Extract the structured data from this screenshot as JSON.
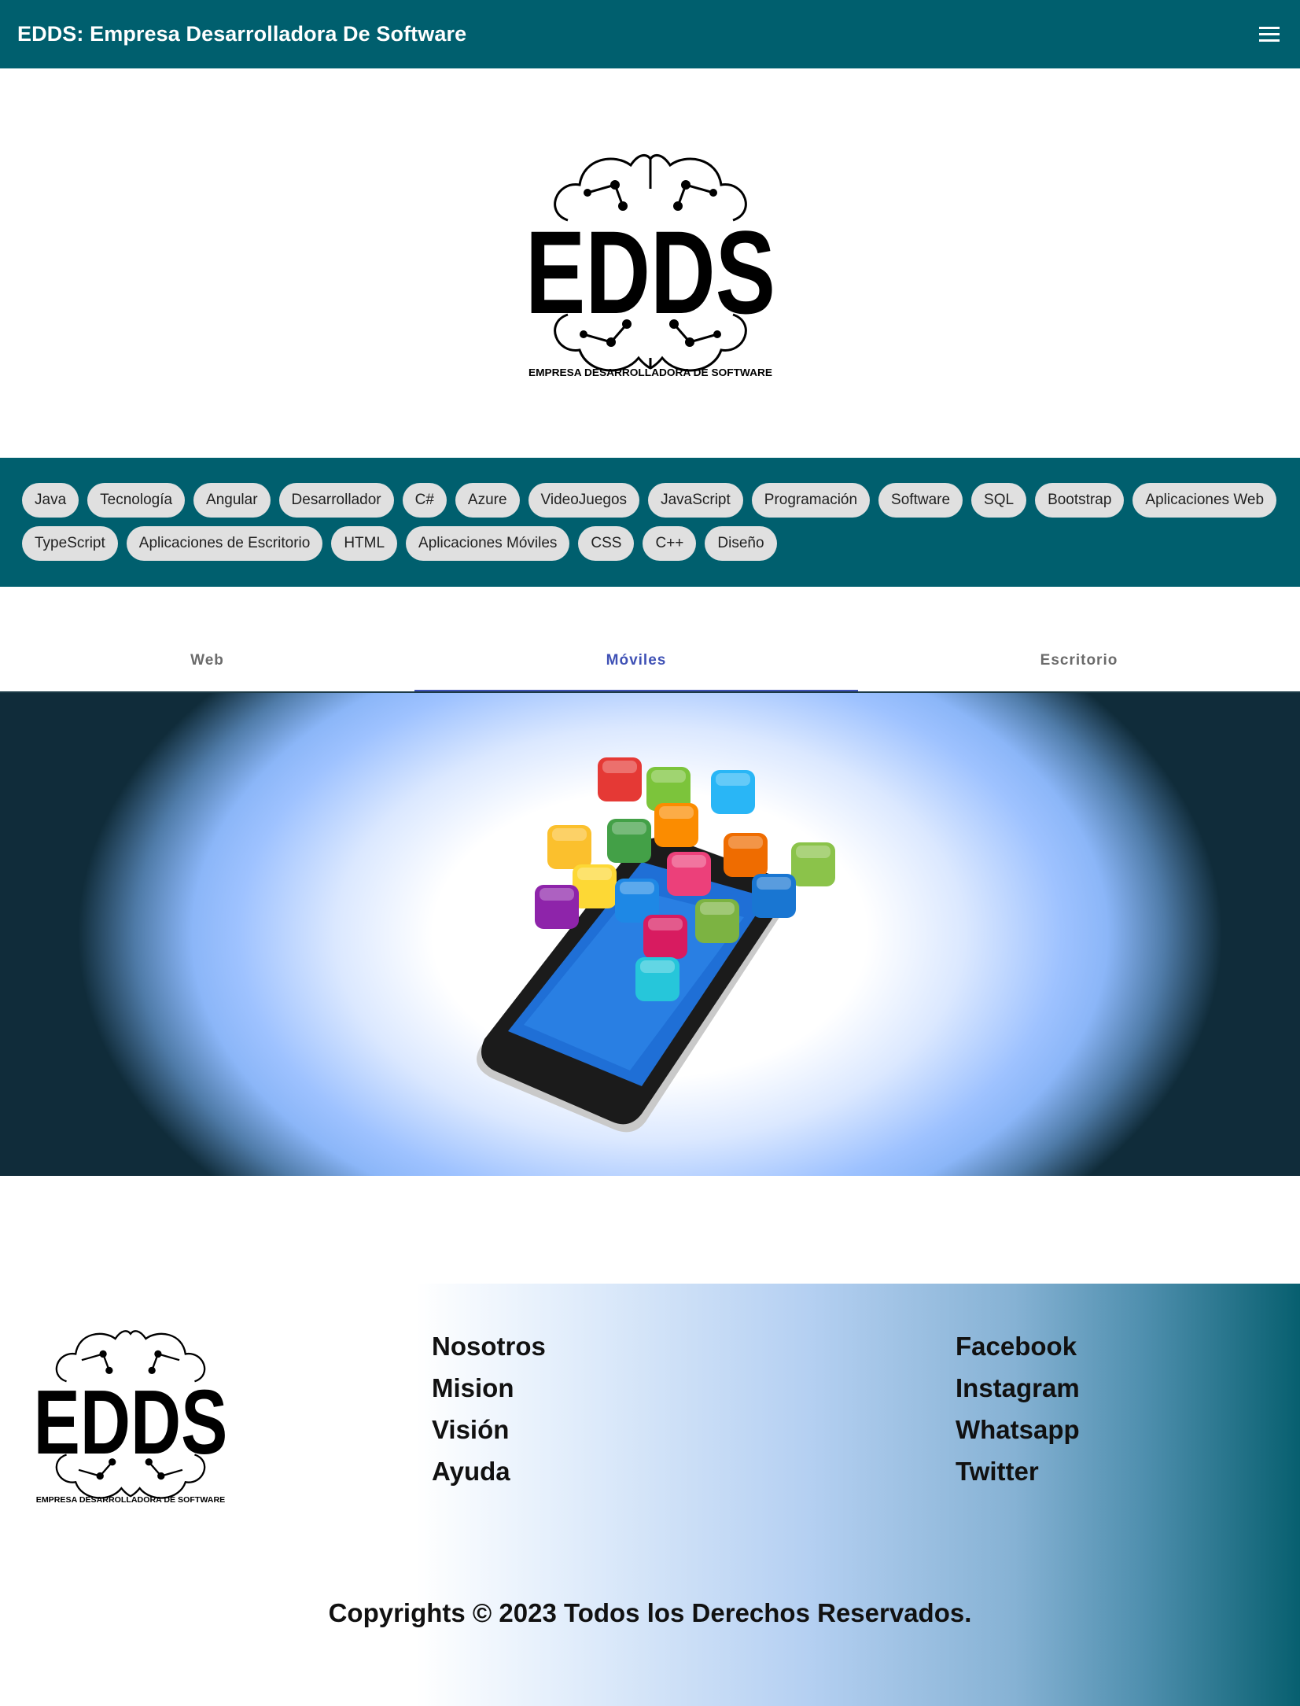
{
  "header": {
    "title": "EDDS: Empresa Desarrolladora De Software"
  },
  "logo": {
    "letters": "EDDS",
    "tagline": "EMPRESA DESARROLLADORA DE SOFTWARE"
  },
  "chips": [
    "Java",
    "Tecnología",
    "Angular",
    "Desarrollador",
    "C#",
    "Azure",
    "VideoJuegos",
    "JavaScript",
    "Programación",
    "Software",
    "SQL",
    "Bootstrap",
    "Aplicaciones Web",
    "TypeScript",
    "Aplicaciones de Escritorio",
    "HTML",
    "Aplicaciones Móviles",
    "CSS",
    "C++",
    "Diseño"
  ],
  "tabs": [
    {
      "label": "Web",
      "active": false
    },
    {
      "label": "Móviles",
      "active": true
    },
    {
      "label": "Escritorio",
      "active": false
    }
  ],
  "footer": {
    "links_left": [
      "Nosotros",
      "Mision",
      "Visión",
      "Ayuda"
    ],
    "links_right": [
      "Facebook",
      "Instagram",
      "Whatsapp",
      "Twitter"
    ],
    "copyright": "Copyrights © 2023 Todos los Derechos Reservados."
  },
  "colors": {
    "primary": "#005f6e",
    "tab_active": "#3f51b5",
    "chip_bg": "#e0e0e0"
  }
}
